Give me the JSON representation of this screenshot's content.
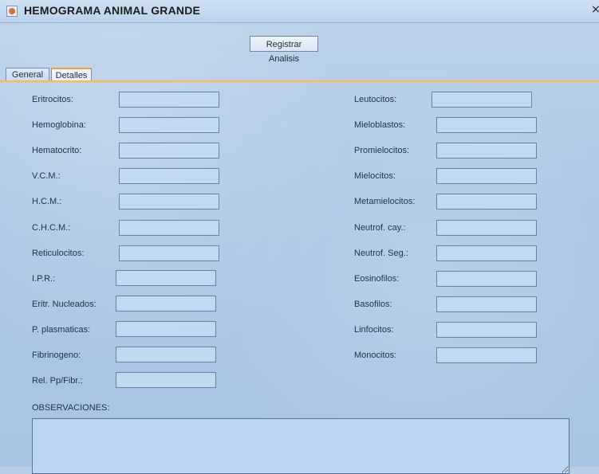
{
  "window": {
    "title": "HEMOGRAMA ANIMAL GRANDE",
    "close_glyph": "×"
  },
  "toolbar": {
    "register_label": "Registrar Analisis"
  },
  "tabs": [
    {
      "label": "General"
    },
    {
      "label": "Detalles"
    }
  ],
  "left_fields": [
    {
      "label": "Eritrocitos:",
      "value": ""
    },
    {
      "label": "Hemoglobina:",
      "value": ""
    },
    {
      "label": "Hematocrito:",
      "value": ""
    },
    {
      "label": "V.C.M.:",
      "value": ""
    },
    {
      "label": "H.C.M.:",
      "value": ""
    },
    {
      "label": "C.H.C.M.:",
      "value": ""
    },
    {
      "label": "Reticulocitos:",
      "value": ""
    },
    {
      "label": "I.P.R.:",
      "value": ""
    },
    {
      "label": "Eritr. Nucleados:",
      "value": ""
    },
    {
      "label": "P. plasmaticas:",
      "value": ""
    },
    {
      "label": "Fibrinogeno:",
      "value": ""
    },
    {
      "label": "Rel. Pp/Fibr.:",
      "value": ""
    }
  ],
  "right_fields": [
    {
      "label": "Leutocitos:",
      "value": ""
    },
    {
      "label": "Mieloblastos:",
      "value": ""
    },
    {
      "label": "Promielocitos:",
      "value": ""
    },
    {
      "label": "Mielocitos:",
      "value": ""
    },
    {
      "label": "Metamielocitos:",
      "value": ""
    },
    {
      "label": "Neutrof. cay.:",
      "value": ""
    },
    {
      "label": "Neutrof. Seg.:",
      "value": ""
    },
    {
      "label": "Eosinofilos:",
      "value": ""
    },
    {
      "label": "Basofilos:",
      "value": ""
    },
    {
      "label": "Linfocitos:",
      "value": ""
    },
    {
      "label": "Monocitos:",
      "value": ""
    }
  ],
  "observaciones": {
    "label": "OBSERVACIONES:",
    "value": ""
  }
}
